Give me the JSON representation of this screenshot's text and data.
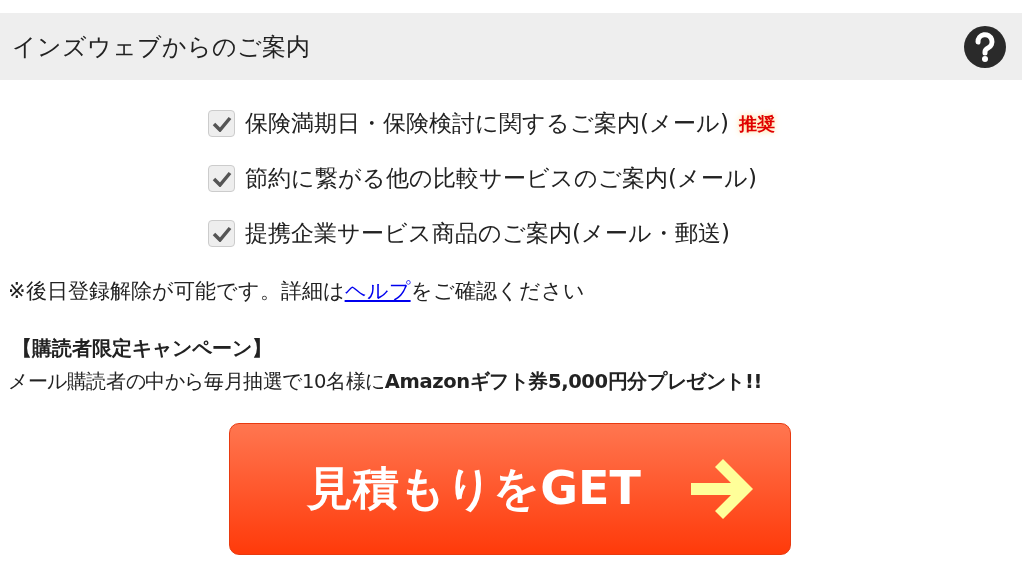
{
  "header": {
    "title": "インズウェブからのご案内"
  },
  "options": [
    {
      "label": "保険満期日・保険検討に関するご案内(メール)",
      "badge": "推奨",
      "checked": true
    },
    {
      "label": "節約に繋がる他の比較サービスのご案内(メール)",
      "checked": true
    },
    {
      "label": "提携企業サービス商品のご案内(メール・郵送)",
      "checked": true
    }
  ],
  "note": {
    "before": "※後日登録解除が可能です。詳細は",
    "link": "ヘルプ",
    "after": "をご確認ください"
  },
  "campaign": {
    "title": "【購読者限定キャンペーン】",
    "text": "メール購読者の中から毎月抽選で10名様に**Amazonギフト券5,000円分プレゼント!!**"
  },
  "submit": {
    "label": "見積もりをGET"
  }
}
